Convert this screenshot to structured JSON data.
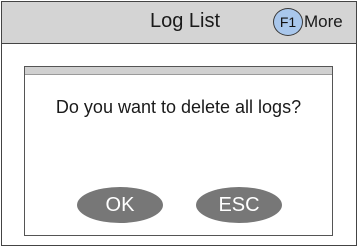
{
  "header": {
    "title": "Log List",
    "f1_key": "F1",
    "more_label": "More"
  },
  "dialog": {
    "message": "Do you want to delete all logs?",
    "ok_label": "OK",
    "esc_label": "ESC"
  },
  "colors": {
    "header_bg": "#d4d4d4",
    "f1_badge": "#a9c7ec",
    "button_bg": "#777777",
    "button_text": "#ffffff"
  }
}
